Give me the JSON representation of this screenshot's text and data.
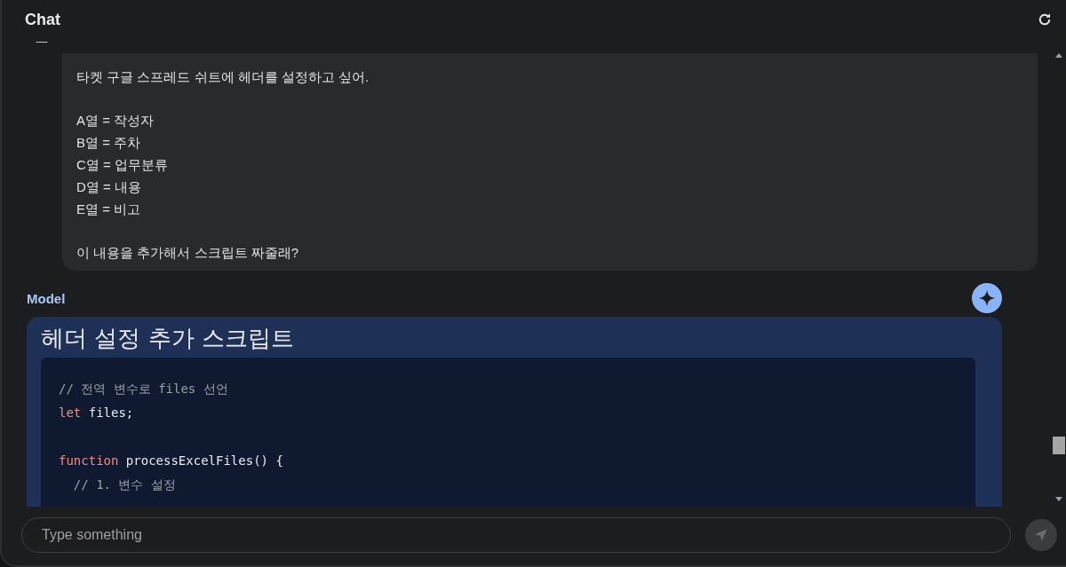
{
  "header": {
    "title": "Chat"
  },
  "collapse_mark": "—",
  "user_message": {
    "paragraphs": [
      [
        "타켓 구글 스프레드 쉬트에 헤더를 설정하고 싶어."
      ],
      [
        "A열 = 작성자",
        "B열 = 주차",
        "C열 = 업무분류",
        "D열 = 내용",
        "E열 = 비고"
      ],
      [
        "이 내용을 추가해서 스크립트 짜줄래?"
      ]
    ]
  },
  "model_message": {
    "label": "Model",
    "title": "헤더 설정 추가 스크립트",
    "code_lines": [
      {
        "kind": "code",
        "tokens": [
          {
            "kind": "comment",
            "text": "// 전역 변수로 files 선언"
          }
        ]
      },
      {
        "kind": "code",
        "tokens": [
          {
            "kind": "keyword",
            "text": "let"
          },
          {
            "kind": "plain",
            "text": " files;"
          }
        ]
      },
      {
        "kind": "blank"
      },
      {
        "kind": "code",
        "tokens": [
          {
            "kind": "keyword",
            "text": "function"
          },
          {
            "kind": "plain",
            "text": " processExcelFiles() {"
          }
        ]
      },
      {
        "kind": "code",
        "tokens": [
          {
            "kind": "comment",
            "text": "  // 1. 변수 설정"
          }
        ]
      }
    ]
  },
  "input": {
    "placeholder": "Type something"
  }
}
